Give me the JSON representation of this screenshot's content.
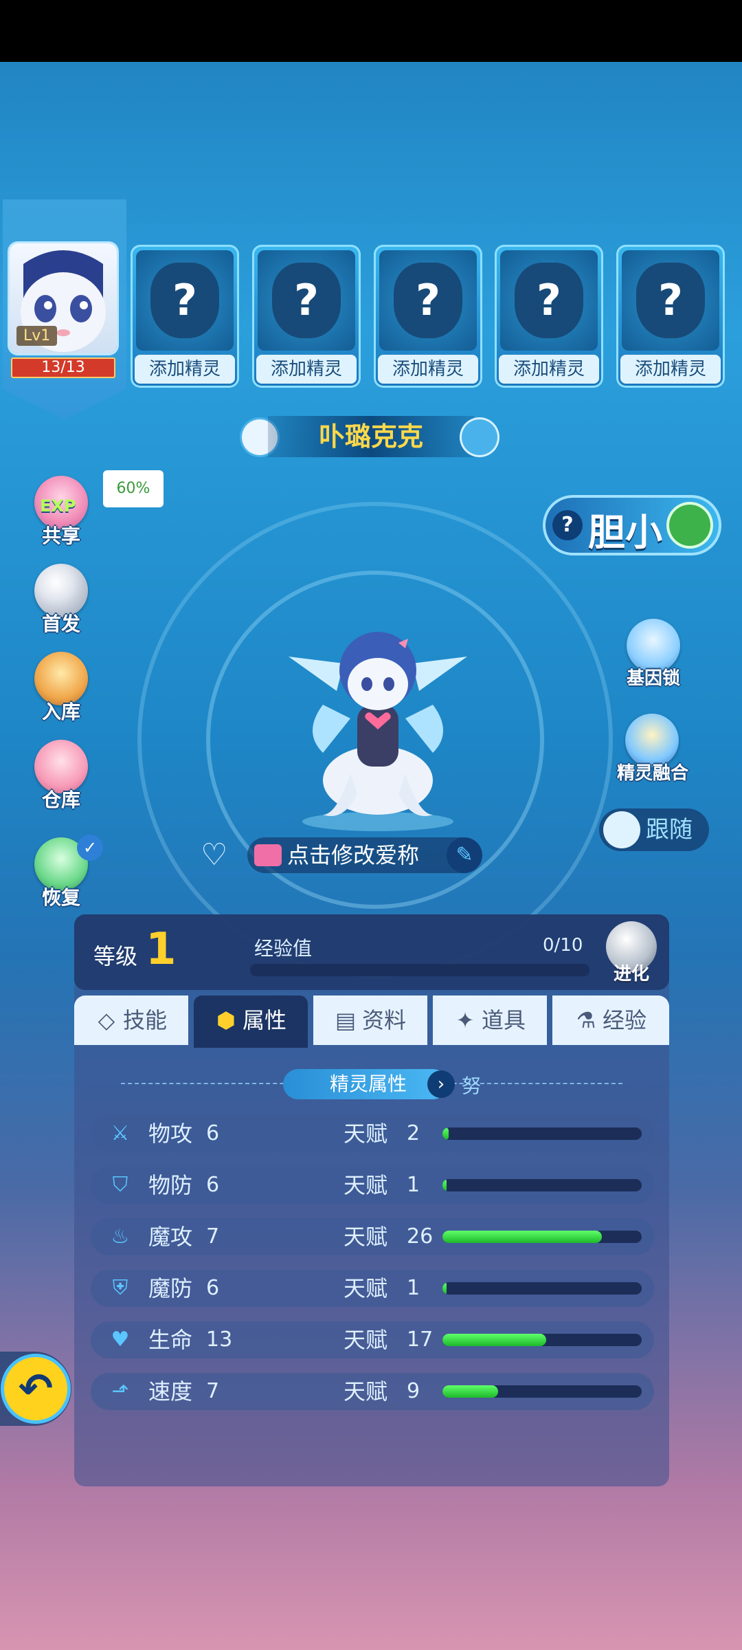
{
  "team": {
    "active": {
      "level": "Lv1",
      "hp": "13/13"
    },
    "empty_slot_label": "添加精灵",
    "empty_slot_mark": "?",
    "empty_slots": 5
  },
  "pet": {
    "name": "卟璐克克",
    "nickname_hint": "点击修改爱称"
  },
  "left_menu": {
    "share": {
      "label": "共享",
      "badge": "EXP",
      "percent": "60%"
    },
    "first": {
      "label": "首发"
    },
    "store": {
      "label": "入库"
    },
    "warehouse": {
      "label": "仓库"
    },
    "restore": {
      "label": "恢复"
    }
  },
  "right_menu": {
    "trait": {
      "help": "?",
      "label": "胆小"
    },
    "gene_lock": {
      "label": "基因锁"
    },
    "fusion": {
      "label": "精灵融合"
    },
    "follow": {
      "label": "跟随"
    }
  },
  "level": {
    "label": "等级",
    "value": "1",
    "exp_label": "经验值",
    "exp_value": "0/10",
    "exp_fraction": 0,
    "evolve_label": "进化"
  },
  "tabs": [
    {
      "label": "技能",
      "icon": "diamond-icon"
    },
    {
      "label": "属性",
      "icon": "hexagon-icon",
      "active": true
    },
    {
      "label": "资料",
      "icon": "clipboard-icon"
    },
    {
      "label": "道具",
      "icon": "star-icon"
    },
    {
      "label": "经验",
      "icon": "flask-icon"
    }
  ],
  "section": {
    "title": "精灵属性",
    "nature": "努"
  },
  "talent_label": "天赋",
  "stats": [
    {
      "name": "物攻",
      "value": "6",
      "talent": "2",
      "fill": 0.03,
      "icon": "sword-icon"
    },
    {
      "name": "物防",
      "value": "6",
      "talent": "1",
      "fill": 0.015,
      "icon": "shield-icon"
    },
    {
      "name": "魔攻",
      "value": "7",
      "talent": "26",
      "fill": 0.8,
      "icon": "flame-icon"
    },
    {
      "name": "魔防",
      "value": "6",
      "talent": "1",
      "fill": 0.015,
      "icon": "magic-shield-icon"
    },
    {
      "name": "生命",
      "value": "13",
      "talent": "17",
      "fill": 0.52,
      "icon": "heart-plus-icon"
    },
    {
      "name": "速度",
      "value": "7",
      "talent": "9",
      "fill": 0.28,
      "icon": "boot-icon"
    }
  ],
  "colors": {
    "gold": "#ffd02c",
    "bar_green": "#1db82a",
    "hp_red": "#d33a2a"
  }
}
